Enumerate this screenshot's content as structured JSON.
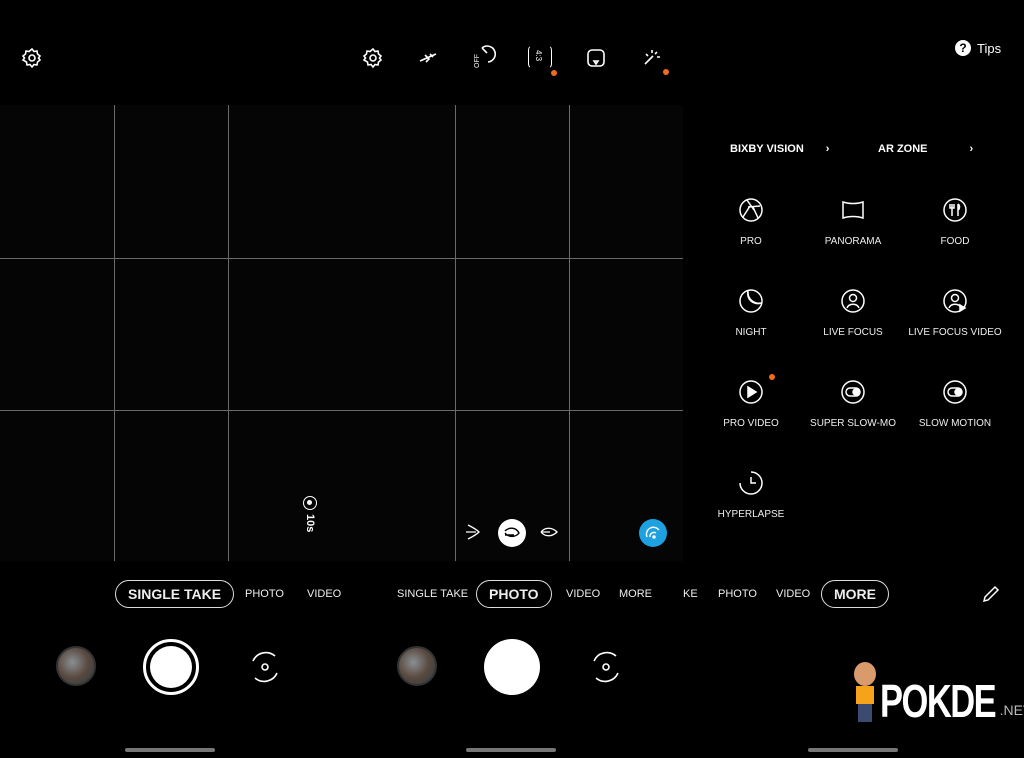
{
  "panel1": {
    "modes": [
      "SINGLE TAKE",
      "PHOTO",
      "VIDEO"
    ],
    "selected": "SINGLE TAKE",
    "timer": "10s"
  },
  "panel2": {
    "modes": [
      "SINGLE TAKE",
      "PHOTO",
      "VIDEO",
      "MORE"
    ],
    "selected": "PHOTO",
    "top_icons": [
      "settings-icon",
      "flash-off-icon",
      "timer-off-icon",
      "aspect-ratio-icon",
      "motion-photo-icon",
      "filters-icon"
    ],
    "aspect_label": "4:3",
    "timer_label": "OFF",
    "zoom_icons": [
      "ultra-wide-icon",
      "wide-icon",
      "telephoto-icon"
    ],
    "scene_optimizer_color": "#1ea1e0"
  },
  "panel3": {
    "tips": "Tips",
    "modes": [
      "KE",
      "PHOTO",
      "VIDEO",
      "MORE"
    ],
    "selected": "MORE",
    "links": [
      {
        "label": "BIXBY VISION"
      },
      {
        "label": "AR ZONE"
      }
    ],
    "items": [
      {
        "label": "PRO",
        "icon": "aperture-icon"
      },
      {
        "label": "PANORAMA",
        "icon": "panorama-icon"
      },
      {
        "label": "FOOD",
        "icon": "food-icon"
      },
      {
        "label": "NIGHT",
        "icon": "moon-icon"
      },
      {
        "label": "LIVE FOCUS",
        "icon": "portrait-icon"
      },
      {
        "label": "LIVE FOCUS VIDEO",
        "icon": "portrait-video-icon"
      },
      {
        "label": "PRO VIDEO",
        "icon": "play-icon"
      },
      {
        "label": "SUPER SLOW-MO",
        "icon": "slow-mo-icon"
      },
      {
        "label": "SLOW MOTION",
        "icon": "slow-motion-icon"
      },
      {
        "label": "HYPERLAPSE",
        "icon": "hyperlapse-icon"
      }
    ]
  },
  "accent": "#f26b1d",
  "watermark": "POKDE.NET"
}
